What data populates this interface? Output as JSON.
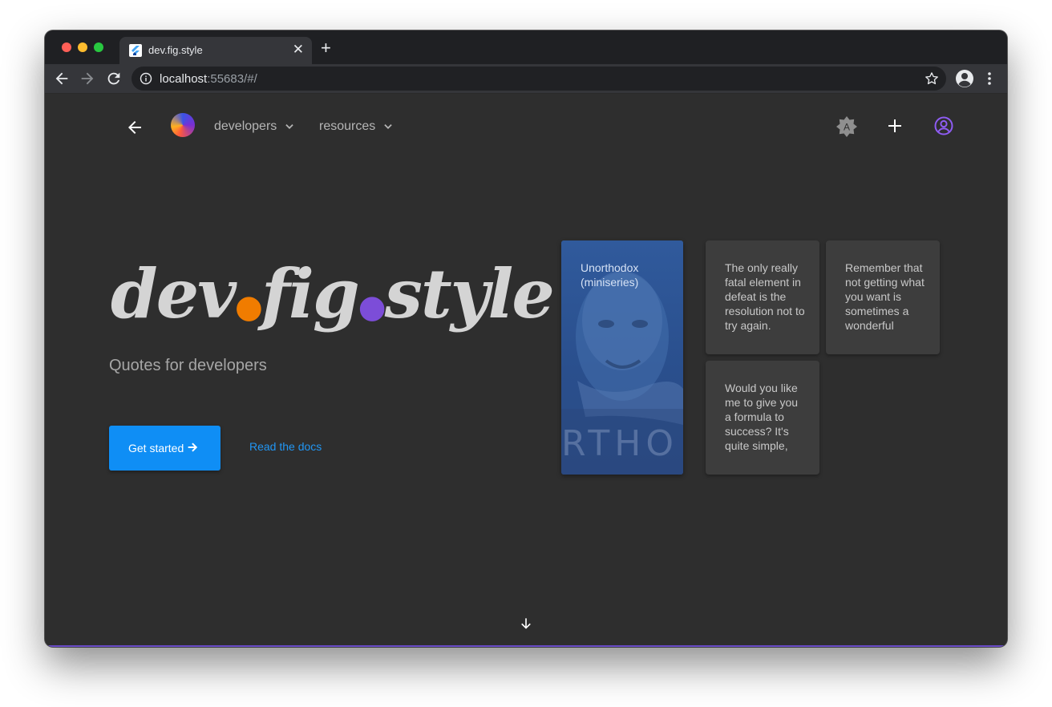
{
  "browser": {
    "tab_title": "dev.fig.style",
    "url_host": "localhost",
    "url_rest": ":55683/#/"
  },
  "nav": {
    "developers_label": "developers",
    "resources_label": "resources",
    "theme_icon_letter": "A"
  },
  "hero": {
    "title_part1": "dev",
    "title_part2": "fig",
    "title_part3": "style",
    "subtitle": "Quotes for developers",
    "cta_label": "Get started",
    "docs_label": "Read the docs"
  },
  "cards": {
    "image_card_title": "Unorthodox (miniseries)",
    "image_watermark": "RTHO",
    "quotes": [
      "The only really fatal element in defeat is the resolution not to try again.",
      "Remember that not getting what you want is sometimes a wonderful",
      "Would you like me to give you a formula to success? It's quite simple,"
    ]
  },
  "colors": {
    "page_bg": "#2e2e2e",
    "accent_blue": "#0f8ef5",
    "accent_purple": "#7c4dd8",
    "accent_orange": "#f07c00"
  }
}
